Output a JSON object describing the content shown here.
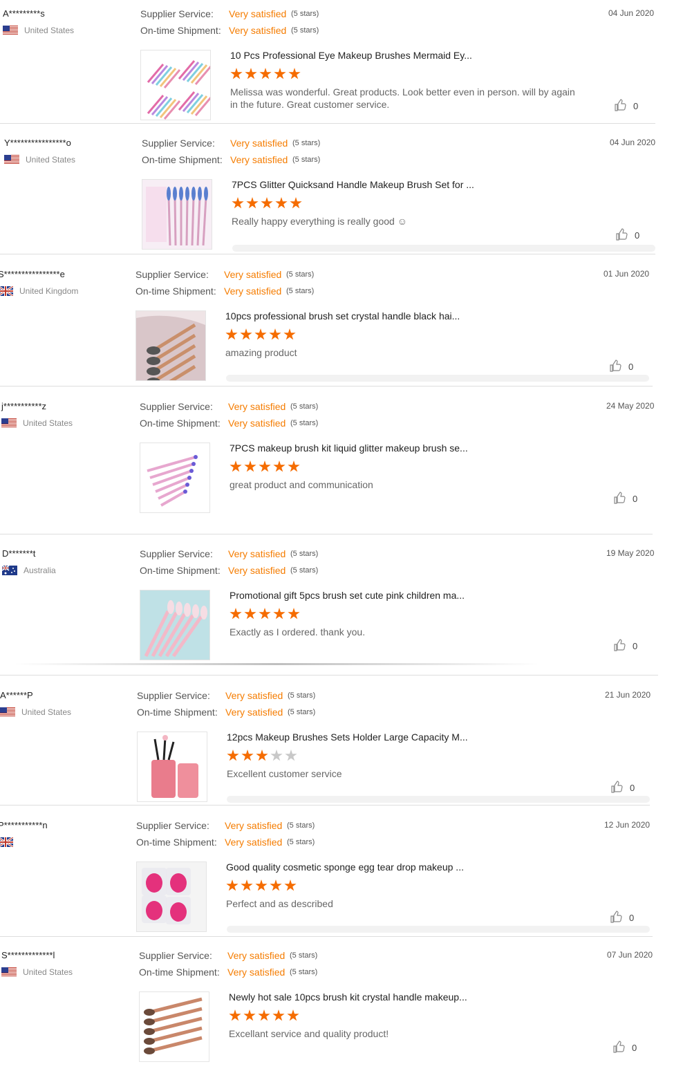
{
  "labels": {
    "supplier_service": "Supplier Service:",
    "ontime_shipment": "On-time Shipment:"
  },
  "colors": {
    "accent": "#f57c00",
    "star_on": "#f56c00",
    "star_off": "#c8c8c8"
  },
  "reviews": [
    {
      "buyer": "A*********s",
      "country": "United States",
      "flag": "us",
      "supplier_value": "Very satisfied",
      "supplier_stars": "(5 stars)",
      "shipment_value": "Very satisfied",
      "shipment_stars": "(5 stars)",
      "date": "04 Jun 2020",
      "product_title": "10 Pcs Professional Eye Makeup Brushes Mermaid Ey...",
      "rating": 5,
      "comment": "Melissa was wonderful. Great products. Look better even in person. will by again in the future. Great customer service.",
      "likes": "0",
      "image": "mermaid-brushes"
    },
    {
      "buyer": "Y****************o",
      "country": "United States",
      "flag": "us",
      "supplier_value": "Very satisfied",
      "supplier_stars": "(5 stars)",
      "shipment_value": "Very satisfied",
      "shipment_stars": "(5 stars)",
      "date": "04 Jun 2020",
      "product_title": "7PCS Glitter Quicksand Handle Makeup Brush Set for ...",
      "rating": 5,
      "comment": "Really happy everything is really good ☺",
      "likes": "0",
      "image": "glitter-brushes"
    },
    {
      "buyer": "S****************e",
      "country": "United Kingdom",
      "flag": "uk",
      "supplier_value": "Very satisfied",
      "supplier_stars": "(5 stars)",
      "shipment_value": "Very satisfied",
      "shipment_stars": "(5 stars)",
      "date": "01 Jun 2020",
      "product_title": "10pcs professional brush set crystal handle black hai...",
      "rating": 5,
      "comment": "amazing product",
      "likes": "0",
      "image": "crystal-brushes"
    },
    {
      "buyer": "j***********z",
      "country": "United States",
      "flag": "us",
      "supplier_value": "Very satisfied",
      "supplier_stars": "(5 stars)",
      "shipment_value": "Very satisfied",
      "shipment_stars": "(5 stars)",
      "date": "24 May 2020",
      "product_title": "7PCS makeup brush kit liquid glitter makeup brush se...",
      "rating": 5,
      "comment": "great product and communication",
      "likes": "0",
      "image": "liquid-glitter-brushes"
    },
    {
      "buyer": "D*******t",
      "country": "Australia",
      "flag": "au",
      "supplier_value": "Very satisfied",
      "supplier_stars": "(5 stars)",
      "shipment_value": "Very satisfied",
      "shipment_stars": "(5 stars)",
      "date": "19 May 2020",
      "product_title": "Promotional gift 5pcs brush set cute pink children ma...",
      "rating": 5,
      "comment": "Exactly as I ordered. thank you.",
      "likes": "0",
      "image": "pink-brushes"
    },
    {
      "buyer": "A******P",
      "country": "United States",
      "flag": "us",
      "supplier_value": "Very satisfied",
      "supplier_stars": "(5 stars)",
      "shipment_value": "Very satisfied",
      "shipment_stars": "(5 stars)",
      "date": "21 Jun 2020",
      "product_title": "12pcs Makeup Brushes Sets Holder Large Capacity M...",
      "rating": 3,
      "comment": "Excellent customer service",
      "likes": "0",
      "image": "brush-holder"
    },
    {
      "buyer": "P***********n",
      "country": "",
      "flag": "uk",
      "supplier_value": "Very satisfied",
      "supplier_stars": "(5 stars)",
      "shipment_value": "Very satisfied",
      "shipment_stars": "(5 stars)",
      "date": "12 Jun 2020",
      "product_title": "Good quality cosmetic sponge egg tear drop makeup ...",
      "rating": 5,
      "comment": "Perfect and as described",
      "likes": "0",
      "image": "sponges"
    },
    {
      "buyer": "S*************l",
      "country": "United States",
      "flag": "us",
      "supplier_value": "Very satisfied",
      "supplier_stars": "(5 stars)",
      "shipment_value": "Very satisfied",
      "shipment_stars": "(5 stars)",
      "date": "07 Jun 2020",
      "product_title": "Newly hot sale 10pcs brush kit crystal handle makeup...",
      "rating": 5,
      "comment": "Excellant service and quality product!",
      "likes": "0",
      "image": "rose-gold-brushes"
    }
  ]
}
